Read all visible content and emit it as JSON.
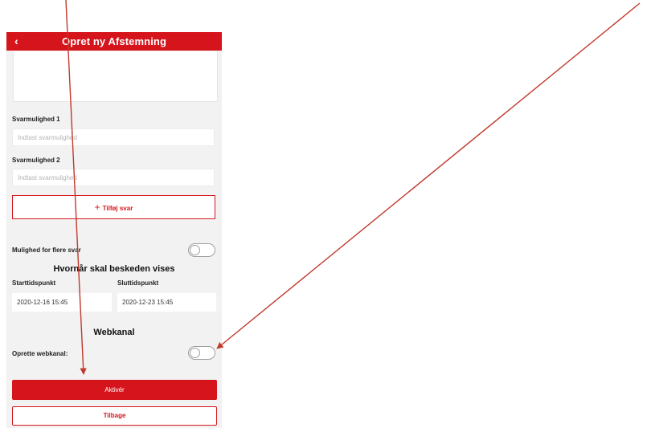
{
  "header": {
    "title": "Opret ny Afstemning",
    "back_icon": "chevron-left-icon"
  },
  "options": [
    {
      "label": "Svarmulighed 1",
      "placeholder": "Indtast svarmulighed"
    },
    {
      "label": "Svarmulighed 2",
      "placeholder": "Indtast svarmulighed"
    }
  ],
  "add_answer": {
    "icon": "+",
    "label": "Tilføj svar"
  },
  "multiple_answers": {
    "label": "Mulighed for flere svar",
    "enabled": false
  },
  "schedule": {
    "title": "Hvornår skal beskeden vises",
    "start_label": "Starttidspunkt",
    "start_value": "2020-12-16 15:45",
    "end_label": "Sluttidspunkt",
    "end_value": "2020-12-23 15:45"
  },
  "webchannel": {
    "title": "Webkanal",
    "label": "Oprette webkanal:",
    "enabled": false
  },
  "actions": {
    "activate": "Aktivér",
    "back": "Tilbage"
  },
  "colors": {
    "accent": "#d6141c",
    "background": "#f2f2f2",
    "annotation_arrow": "#c0392b"
  }
}
